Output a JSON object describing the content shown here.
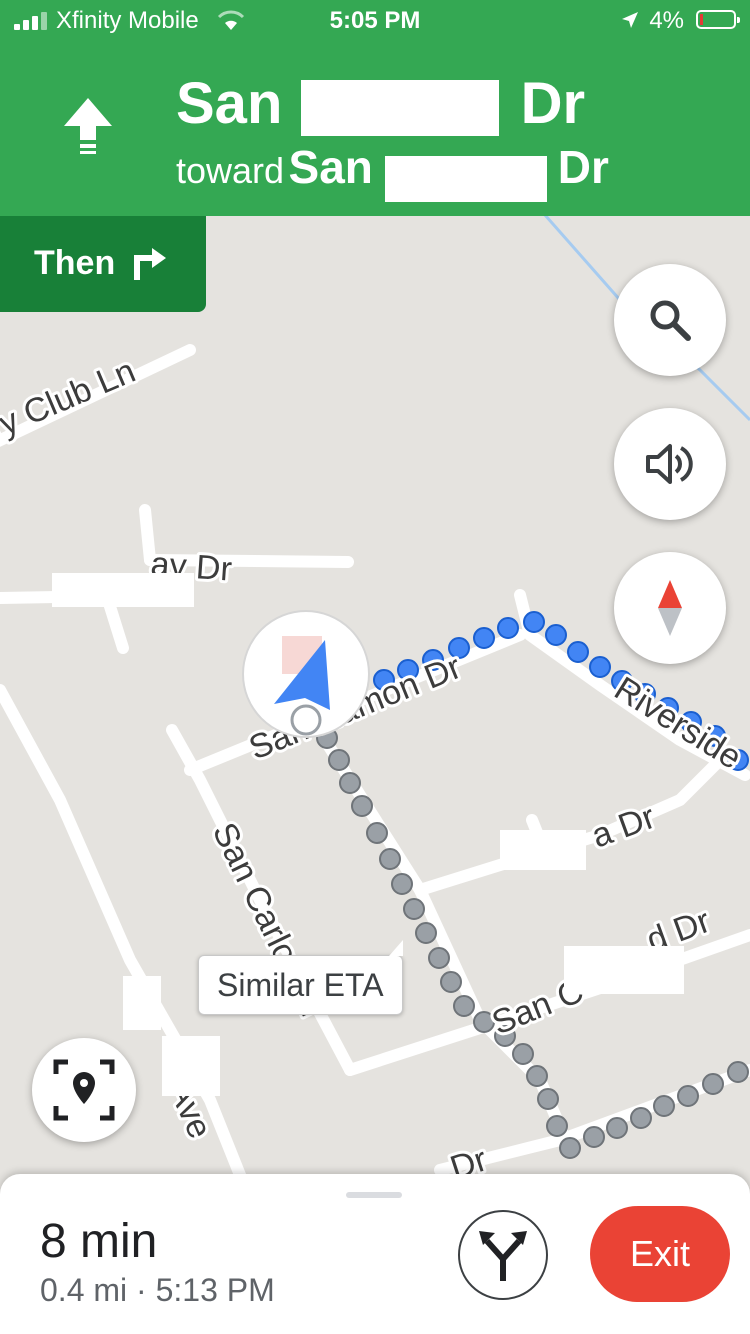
{
  "status_bar": {
    "carrier": "Xfinity Mobile",
    "time": "5:05 PM",
    "battery": "4%"
  },
  "navigation": {
    "primary_prefix": "San",
    "primary_suffix": "Dr",
    "toward_label": "toward",
    "secondary_prefix": "San",
    "secondary_suffix": "Dr",
    "then_label": "Then",
    "header_color": "#34a853",
    "then_color": "#188038"
  },
  "map": {
    "streets": {
      "country_club": "ry Club Ln",
      "way_dr": "ay Dr",
      "san_ramon": "San Ramon Dr",
      "riverside": "Riverside",
      "san_carlos": "San Carlos Dr",
      "a_dr": "a Dr",
      "d_dr": "d Dr",
      "san_c": "San C",
      "ave": "Ave",
      "dr_bottom": "Dr"
    },
    "eta_chip": "Similar ETA",
    "route_color": "#4285f4",
    "alt_route_color": "#9aa0a6"
  },
  "trip": {
    "duration": "8 min",
    "details": "0.4 mi · 5:13 PM",
    "exit_label": "Exit",
    "exit_color": "#ea4335"
  }
}
